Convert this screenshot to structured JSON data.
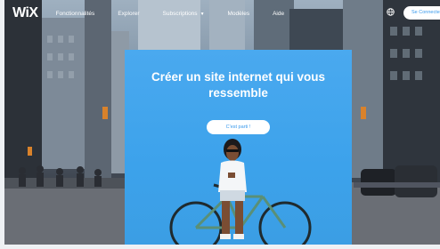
{
  "brand": {
    "logo": "WiX",
    "accent": "#3899ec",
    "hero_color": "#3ca2eb"
  },
  "nav": {
    "items": [
      {
        "label": "Fonctionnalités",
        "dropdown": false
      },
      {
        "label": "Explorer",
        "dropdown": false
      },
      {
        "label": "Subscriptions",
        "dropdown": true
      },
      {
        "label": "Modèles",
        "dropdown": false
      },
      {
        "label": "Aide",
        "dropdown": false
      }
    ],
    "login_label": "Se Connecter",
    "globe_icon": "globe-icon"
  },
  "hero": {
    "title": "Créer un site internet qui vous ressemble",
    "cta_label": "C'est parti !"
  }
}
